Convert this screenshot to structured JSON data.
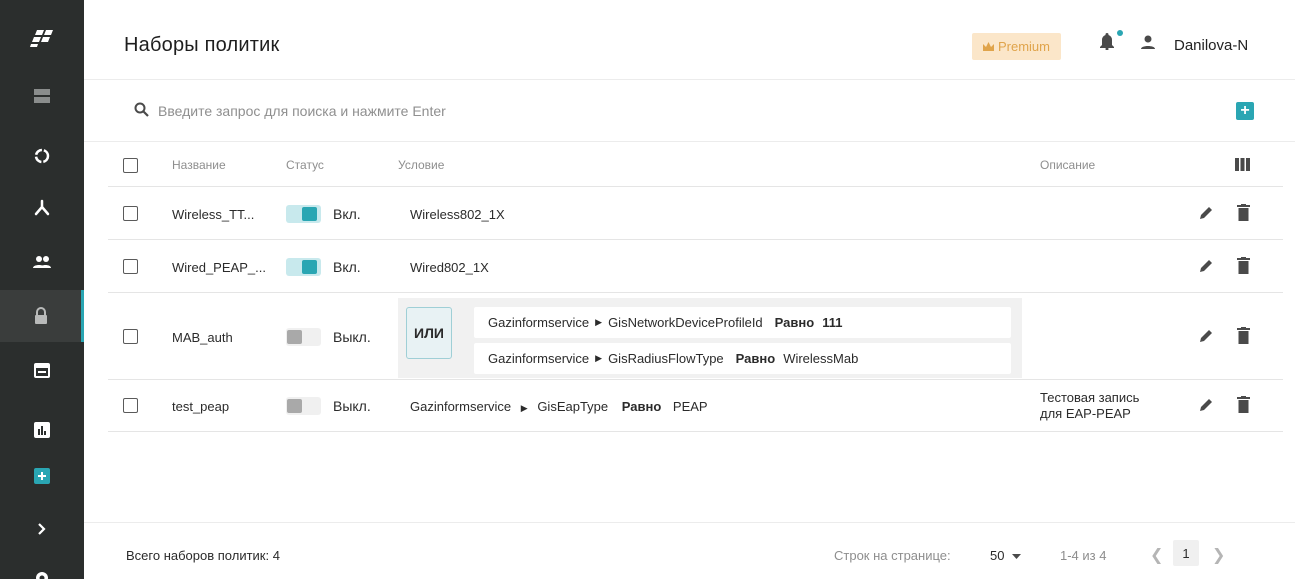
{
  "header": {
    "title": "Наборы политик",
    "premium_label": "Premium",
    "username": "Danilova-N"
  },
  "search": {
    "placeholder": "Введите запрос для поиска и нажмите Enter"
  },
  "table": {
    "columns": {
      "name": "Название",
      "status": "Статус",
      "condition": "Условие",
      "description": "Описание"
    },
    "rows": [
      {
        "name": "Wireless_TT...",
        "enabled": true,
        "status": "Вкл.",
        "condition": "Wireless802_1X",
        "description": ""
      },
      {
        "name": "Wired_PEAP_...",
        "enabled": true,
        "status": "Вкл.",
        "condition": "Wired802_1X",
        "description": ""
      },
      {
        "name": "MAB_auth",
        "enabled": false,
        "status": "Выкл.",
        "operator": "ИЛИ",
        "conditions": [
          {
            "vendor": "Gazinformservice",
            "attribute": "GisNetworkDeviceProfileId",
            "op": "Равно",
            "value": "111"
          },
          {
            "vendor": "Gazinformservice",
            "attribute": "GisRadiusFlowType",
            "op": "Равно",
            "value": "WirelessMab"
          }
        ],
        "description": ""
      },
      {
        "name": "test_peap",
        "enabled": false,
        "status": "Выкл.",
        "condition_parts": {
          "vendor": "Gazinformservice",
          "attribute": "GisEapType",
          "op": "Равно",
          "value": "PEAP"
        },
        "description_line1": "Тестовая запись",
        "description_line2": "для EAP-PEAP"
      }
    ]
  },
  "footer": {
    "total": "Всего наборов политик: 4",
    "rows_per_page_label": "Строк на странице:",
    "rows_per_page": "50",
    "range": "1-4 из 4",
    "page": "1"
  },
  "icons": {
    "logo": "logo-icon",
    "accent_color": "#2aa6b3",
    "sidebar": [
      "servers-icon",
      "ring-icon",
      "network-icon",
      "users-icon",
      "lock-icon",
      "calendar-icon",
      "chart-icon",
      "add-box-icon",
      "chevron-right-icon",
      "gear-icon"
    ]
  }
}
